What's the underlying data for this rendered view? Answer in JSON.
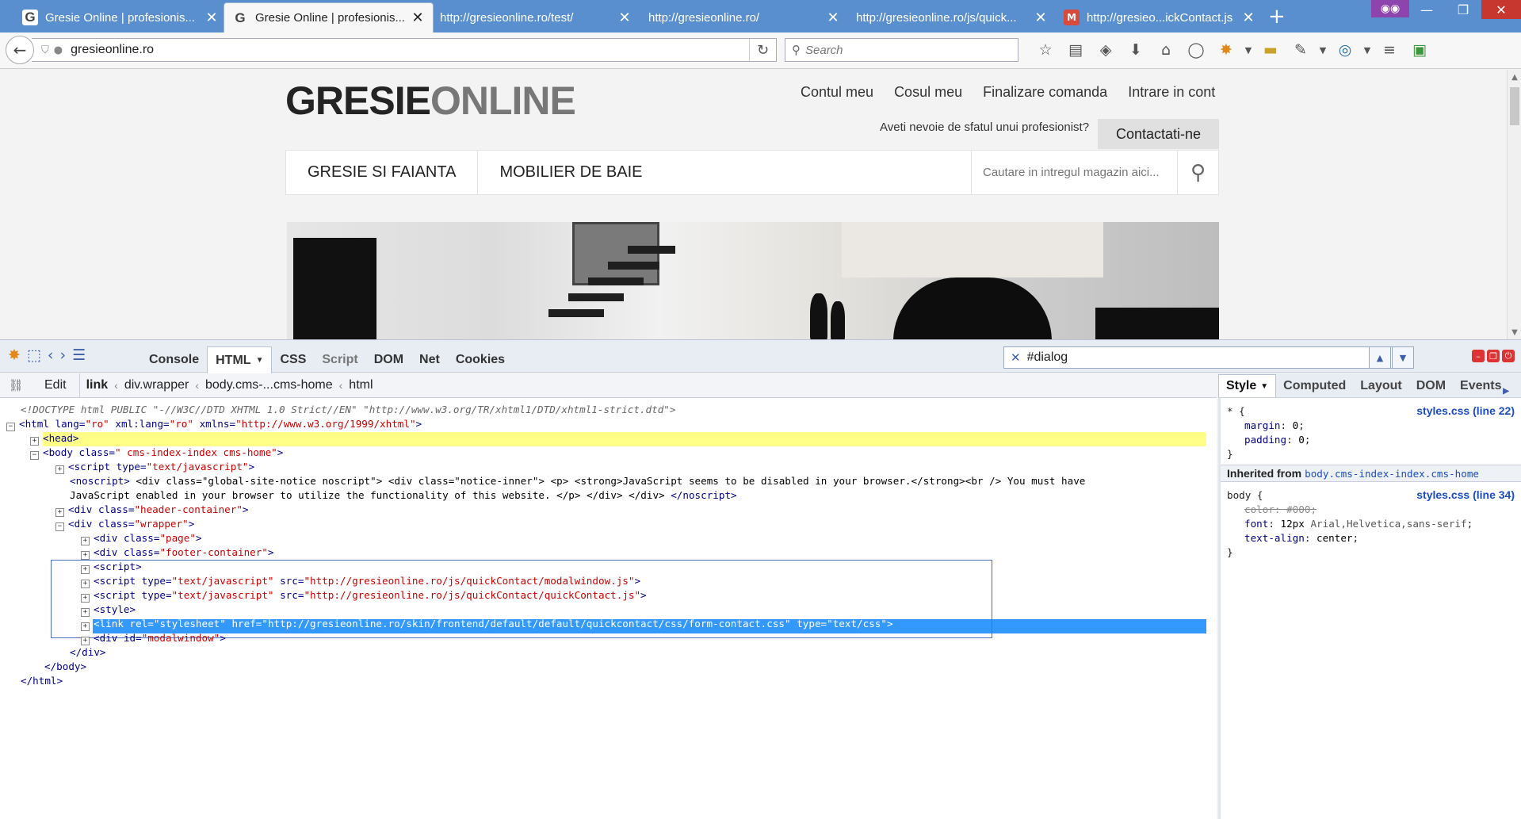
{
  "tabs": [
    {
      "favicon": "G",
      "title": "Gresie Online | profesionis...",
      "active": false
    },
    {
      "favicon": "G",
      "title": "Gresie Online | profesionis...",
      "active": true
    },
    {
      "favicon": "",
      "title": "http://gresieonline.ro/test/",
      "active": false
    },
    {
      "favicon": "",
      "title": "http://gresieonline.ro/",
      "active": false
    },
    {
      "favicon": "",
      "title": "http://gresieonline.ro/js/quick...",
      "active": false
    },
    {
      "favicon": "M",
      "title": "http://gresieo...ickContact.js",
      "active": false
    }
  ],
  "navbar": {
    "url": "gresieonline.ro",
    "search_placeholder": "Search"
  },
  "site": {
    "logo_part1": "GRESIE",
    "logo_part2": "ONLINE",
    "top_links": [
      "Contul meu",
      "Cosul meu",
      "Finalizare comanda",
      "Intrare in cont"
    ],
    "advice_text": "Aveti nevoie de sfatul unui profesionist?",
    "contact_label": "Contactati-ne",
    "categories": [
      "GRESIE SI FAIANTA",
      "MOBILIER DE BAIE"
    ],
    "search_placeholder": "Cautare in intregul magazin aici..."
  },
  "firebug": {
    "panels": [
      "Console",
      "HTML",
      "CSS",
      "Script",
      "DOM",
      "Net",
      "Cookies"
    ],
    "active_panel": "HTML",
    "search_value": "#dialog",
    "edit_label": "Edit",
    "breadcrumbs": [
      "link",
      "div.wrapper",
      "body.cms-...cms-home",
      "html"
    ],
    "side_tabs": [
      "Style",
      "Computed",
      "Layout",
      "DOM",
      "Events"
    ],
    "doctype": "<!DOCTYPE html PUBLIC \"-//W3C//DTD XHTML 1.0 Strict//EN\" \"http://www.w3.org/TR/xhtml1/DTD/xhtml1-strict.dtd\">",
    "noscript_line1": "<div class=\"global-site-notice noscript\"> <div class=\"notice-inner\"> <p> <strong>JavaScript seems to be disabled in your browser.</strong><br /> You must have",
    "noscript_line2": "JavaScript enabled in your browser to utilize the functionality of this website. </p> </div> </div> ",
    "style": {
      "rule1_selector": "* {",
      "rule1_source": "styles.css (line 22)",
      "rule1_props": [
        [
          "margin",
          "0"
        ],
        [
          "padding",
          "0"
        ]
      ],
      "inherited_label": "Inherited from",
      "inherited_selector": "body.cms-index-index.cms-home",
      "rule2_selector": "body {",
      "rule2_source": "styles.css (line 34)",
      "rule2_color": "#000",
      "rule2_font_size": "12px",
      "rule2_font_family": "Arial,Helvetica,sans-serif",
      "rule2_text_align": "center"
    }
  },
  "colors": {
    "tab_strip": "#5a8fcf",
    "selection_blue": "#3399ff",
    "hover_yellow": "#ffff88",
    "tag_blue": "#000088",
    "value_red": "#cc0000"
  }
}
